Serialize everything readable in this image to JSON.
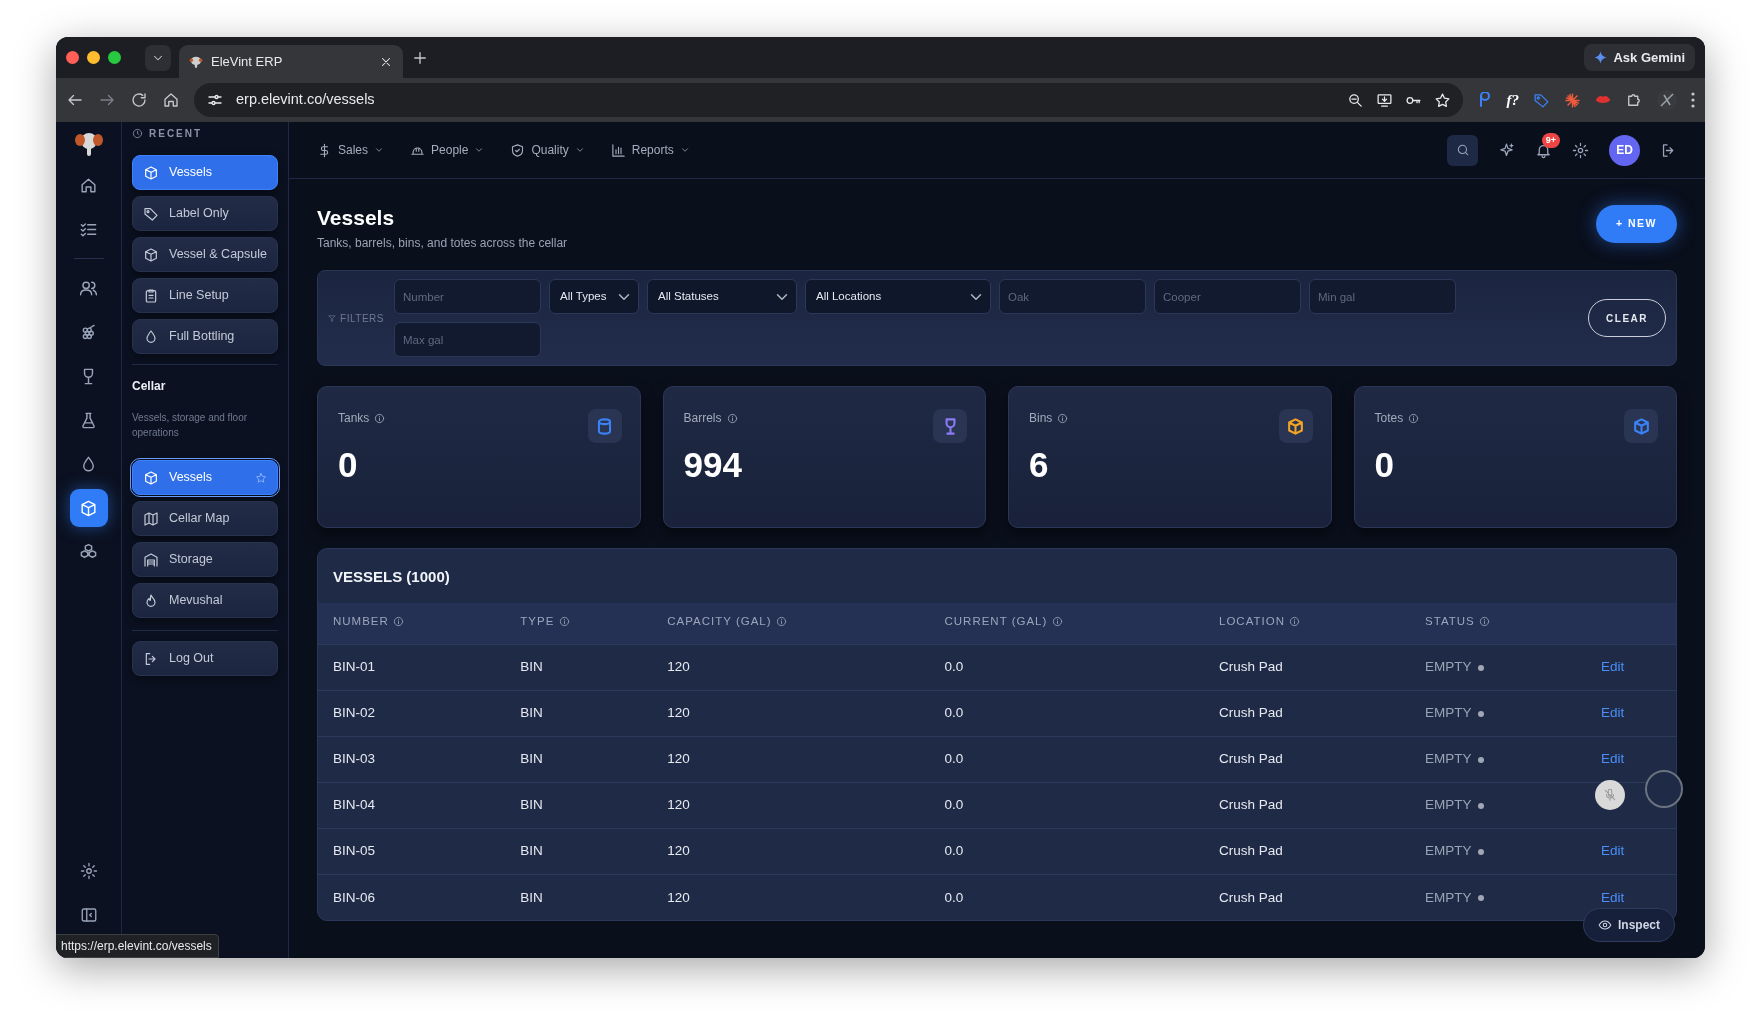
{
  "browser": {
    "tabs": [
      {
        "title": "EleVint ERP",
        "selected": true
      }
    ],
    "address": "erp.elevint.co/vessels",
    "ask_gemini": "Ask Gemini",
    "extension_text": "f?",
    "status_url": "https://erp.elevint.co/vessels"
  },
  "rail": {
    "groups": [
      [
        {
          "kind": "home",
          "selected": false
        },
        {
          "kind": "list",
          "selected": false
        }
      ],
      [
        {
          "kind": "users",
          "selected": false
        },
        {
          "kind": "grapes",
          "selected": false
        },
        {
          "kind": "wine",
          "selected": false
        },
        {
          "kind": "flask",
          "selected": false
        },
        {
          "kind": "drop",
          "selected": false
        },
        {
          "kind": "box",
          "selected": true
        },
        {
          "kind": "cubes",
          "selected": false
        }
      ]
    ]
  },
  "recent": {
    "label": "RECENT",
    "items": [
      {
        "label": "Vessels",
        "kind": "box",
        "selected": true
      },
      {
        "label": "Label Only",
        "kind": "tag",
        "selected": false
      },
      {
        "label": "Vessel & Capsule",
        "kind": "box",
        "selected": false
      },
      {
        "label": "Line Setup",
        "kind": "clipboard",
        "selected": false
      },
      {
        "label": "Full Bottling",
        "kind": "drop",
        "selected": false
      }
    ]
  },
  "section": {
    "title": "Cellar",
    "description": "Vessels, storage and floor operations",
    "items": [
      {
        "label": "Vessels",
        "kind": "box",
        "selected": true
      },
      {
        "label": "Cellar Map",
        "kind": "map",
        "selected": false
      },
      {
        "label": "Storage",
        "kind": "warehouse",
        "selected": false
      },
      {
        "label": "Mevushal",
        "kind": "flame",
        "selected": false
      }
    ],
    "logout": "Log Out"
  },
  "topnav": {
    "menus": [
      {
        "label": "Sales",
        "kind": "dollar"
      },
      {
        "label": "People",
        "kind": "helmet"
      },
      {
        "label": "Quality",
        "kind": "shield"
      },
      {
        "label": "Reports",
        "kind": "chart"
      }
    ],
    "notification_count": "9+",
    "avatar": "ED"
  },
  "page": {
    "title": "Vessels",
    "subtitle": "Tanks, barrels, bins, and totes across the cellar",
    "new_button": "+ NEW"
  },
  "filters": {
    "label": "FILTERS",
    "fields": [
      {
        "kind": "input",
        "placeholder": "Number"
      },
      {
        "kind": "select",
        "value": "All Types"
      },
      {
        "kind": "select",
        "value": "All Statuses"
      },
      {
        "kind": "select",
        "value": "All Locations"
      },
      {
        "kind": "input",
        "placeholder": "Oak"
      },
      {
        "kind": "input",
        "placeholder": "Cooper"
      },
      {
        "kind": "input",
        "placeholder": "Min gal"
      },
      {
        "kind": "input",
        "placeholder": "Max gal"
      }
    ],
    "clear_button": "CLEAR"
  },
  "stats": [
    {
      "label": "Tanks",
      "value": "0",
      "kind": "cylinder",
      "color": "#3b82f6"
    },
    {
      "label": "Barrels",
      "value": "994",
      "kind": "wine",
      "color": "#8b7cf6"
    },
    {
      "label": "Bins",
      "value": "6",
      "kind": "box",
      "color": "#f5a524"
    },
    {
      "label": "Totes",
      "value": "0",
      "kind": "box",
      "color": "#3b82f6"
    }
  ],
  "table": {
    "title": "VESSELS (1000)",
    "columns": [
      "NUMBER",
      "TYPE",
      "CAPACITY (GAL)",
      "CURRENT (GAL)",
      "LOCATION",
      "STATUS"
    ],
    "rows": [
      {
        "cells": [
          "BIN-01",
          "BIN",
          "120",
          "0.0",
          "Crush Pad",
          "EMPTY"
        ],
        "action": "Edit"
      },
      {
        "cells": [
          "BIN-02",
          "BIN",
          "120",
          "0.0",
          "Crush Pad",
          "EMPTY"
        ],
        "action": "Edit"
      },
      {
        "cells": [
          "BIN-03",
          "BIN",
          "120",
          "0.0",
          "Crush Pad",
          "EMPTY"
        ],
        "action": "Edit"
      },
      {
        "cells": [
          "BIN-04",
          "BIN",
          "120",
          "0.0",
          "Crush Pad",
          "EMPTY"
        ]
      },
      {
        "cells": [
          "BIN-05",
          "BIN",
          "120",
          "0.0",
          "Crush Pad",
          "EMPTY"
        ],
        "action": "Edit"
      },
      {
        "cells": [
          "BIN-06",
          "BIN",
          "120",
          "0.0",
          "Crush Pad",
          "EMPTY"
        ],
        "action": "Edit"
      }
    ]
  },
  "inspect_button": "Inspect"
}
